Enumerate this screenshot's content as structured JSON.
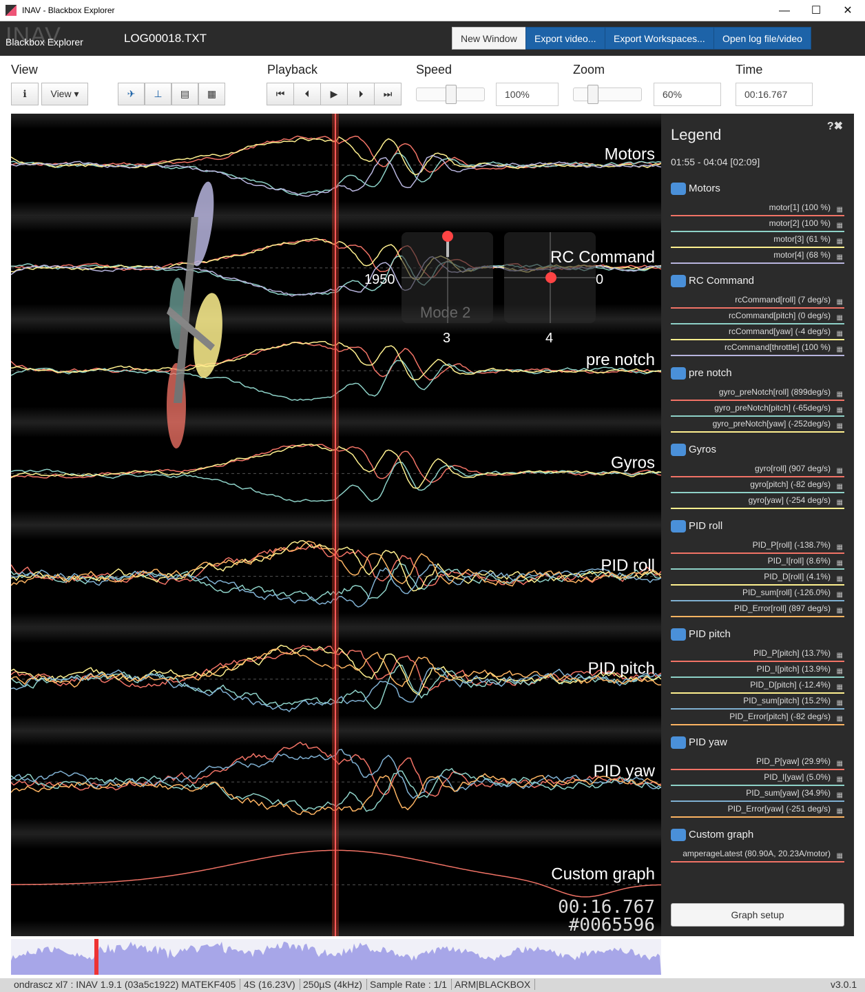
{
  "window": {
    "title": "INAV - Blackbox Explorer",
    "minimize": "—",
    "maximize": "☐",
    "close": "✕"
  },
  "header": {
    "logo_big": "INAV",
    "logo_text": "Blackbox Explorer",
    "filename": "LOG00018.TXT",
    "buttons": {
      "new_window": "New Window",
      "export_video": "Export video...",
      "export_workspaces": "Export Workspaces...",
      "open_log": "Open log file/video"
    }
  },
  "toolbar": {
    "view_label": "View",
    "view_dropdown": "View ▾",
    "info_icon": "ℹ",
    "playback_label": "Playback",
    "speed_label": "Speed",
    "speed_value": "100%",
    "zoom_label": "Zoom",
    "zoom_value": "60%",
    "time_label": "Time",
    "time_value": "00:16.767",
    "playback_icons": {
      "first": "⏮",
      "prev": "⏴",
      "play": "▶",
      "next": "⏵",
      "last": "⏭"
    }
  },
  "graphs": {
    "labels": [
      "Motors",
      "RC Command",
      "pre notch",
      "Gyros",
      "PID roll",
      "PID pitch",
      "PID yaw",
      "Custom graph"
    ],
    "stick_left_value": "1950",
    "stick_right_value": "0",
    "stick_left_bottom": "3",
    "stick_right_bottom": "4",
    "mode": "Mode 2",
    "time_overlay": "00:16.767",
    "frame_overlay": "#0065596"
  },
  "legend": {
    "title": "Legend",
    "range": "01:55 - 04:04 [02:09]",
    "close_icon": "?✖",
    "groups": [
      {
        "name": "Motors",
        "items": [
          {
            "label": "motor[1] (100 %)",
            "color": "#f27366"
          },
          {
            "label": "motor[2] (100 %)",
            "color": "#8ed2c8"
          },
          {
            "label": "motor[3] (61 %)",
            "color": "#fff18f"
          },
          {
            "label": "motor[4] (68 %)",
            "color": "#b8b5de"
          }
        ]
      },
      {
        "name": "RC Command",
        "items": [
          {
            "label": "rcCommand[roll] (7 deg/s)",
            "color": "#f27366"
          },
          {
            "label": "rcCommand[pitch] (0 deg/s)",
            "color": "#8ed2c8"
          },
          {
            "label": "rcCommand[yaw] (-4 deg/s)",
            "color": "#fff18f"
          },
          {
            "label": "rcCommand[throttle] (100 %)",
            "color": "#b8b5de"
          }
        ]
      },
      {
        "name": "pre notch",
        "items": [
          {
            "label": "gyro_preNotch[roll] (899deg/s)",
            "color": "#f27366"
          },
          {
            "label": "gyro_preNotch[pitch] (-65deg/s)",
            "color": "#8ed2c8"
          },
          {
            "label": "gyro_preNotch[yaw] (-252deg/s)",
            "color": "#fff18f"
          }
        ]
      },
      {
        "name": "Gyros",
        "items": [
          {
            "label": "gyro[roll] (907 deg/s)",
            "color": "#f27366"
          },
          {
            "label": "gyro[pitch] (-82 deg/s)",
            "color": "#8ed2c8"
          },
          {
            "label": "gyro[yaw] (-254 deg/s)",
            "color": "#fff18f"
          }
        ]
      },
      {
        "name": "PID roll",
        "items": [
          {
            "label": "PID_P[roll] (-138.7%)",
            "color": "#f27366"
          },
          {
            "label": "PID_I[roll] (8.6%)",
            "color": "#8ed2c8"
          },
          {
            "label": "PID_D[roll] (4.1%)",
            "color": "#fff18f"
          },
          {
            "label": "PID_sum[roll] (-126.0%)",
            "color": "#80b1d3"
          },
          {
            "label": "PID_Error[roll] (897 deg/s)",
            "color": "#fdb462"
          }
        ]
      },
      {
        "name": "PID pitch",
        "items": [
          {
            "label": "PID_P[pitch] (13.7%)",
            "color": "#f27366"
          },
          {
            "label": "PID_I[pitch] (13.9%)",
            "color": "#8ed2c8"
          },
          {
            "label": "PID_D[pitch] (-12.4%)",
            "color": "#fff18f"
          },
          {
            "label": "PID_sum[pitch] (15.2%)",
            "color": "#80b1d3"
          },
          {
            "label": "PID_Error[pitch] (-82 deg/s)",
            "color": "#fdb462"
          }
        ]
      },
      {
        "name": "PID yaw",
        "items": [
          {
            "label": "PID_P[yaw] (29.9%)",
            "color": "#f27366"
          },
          {
            "label": "PID_I[yaw] (5.0%)",
            "color": "#8ed2c8"
          },
          {
            "label": "PID_sum[yaw] (34.9%)",
            "color": "#80b1d3"
          },
          {
            "label": "PID_Error[yaw] (-251 deg/s)",
            "color": "#fdb462"
          }
        ]
      },
      {
        "name": "Custom graph",
        "items": [
          {
            "label": "amperageLatest (80.90A, 20.23A/motor)",
            "color": "#f27366"
          }
        ]
      }
    ],
    "setup_button": "Graph setup"
  },
  "status": {
    "craft": "ondrascz xl7 : INAV 1.9.1 (03a5c1922) MATEKF405",
    "battery": "4S (16.23V)",
    "looptime": "250µS (4kHz)",
    "sample_rate": "Sample Rate : 1/1",
    "flags": "ARM|BLACKBOX",
    "version": "v3.0.1"
  }
}
